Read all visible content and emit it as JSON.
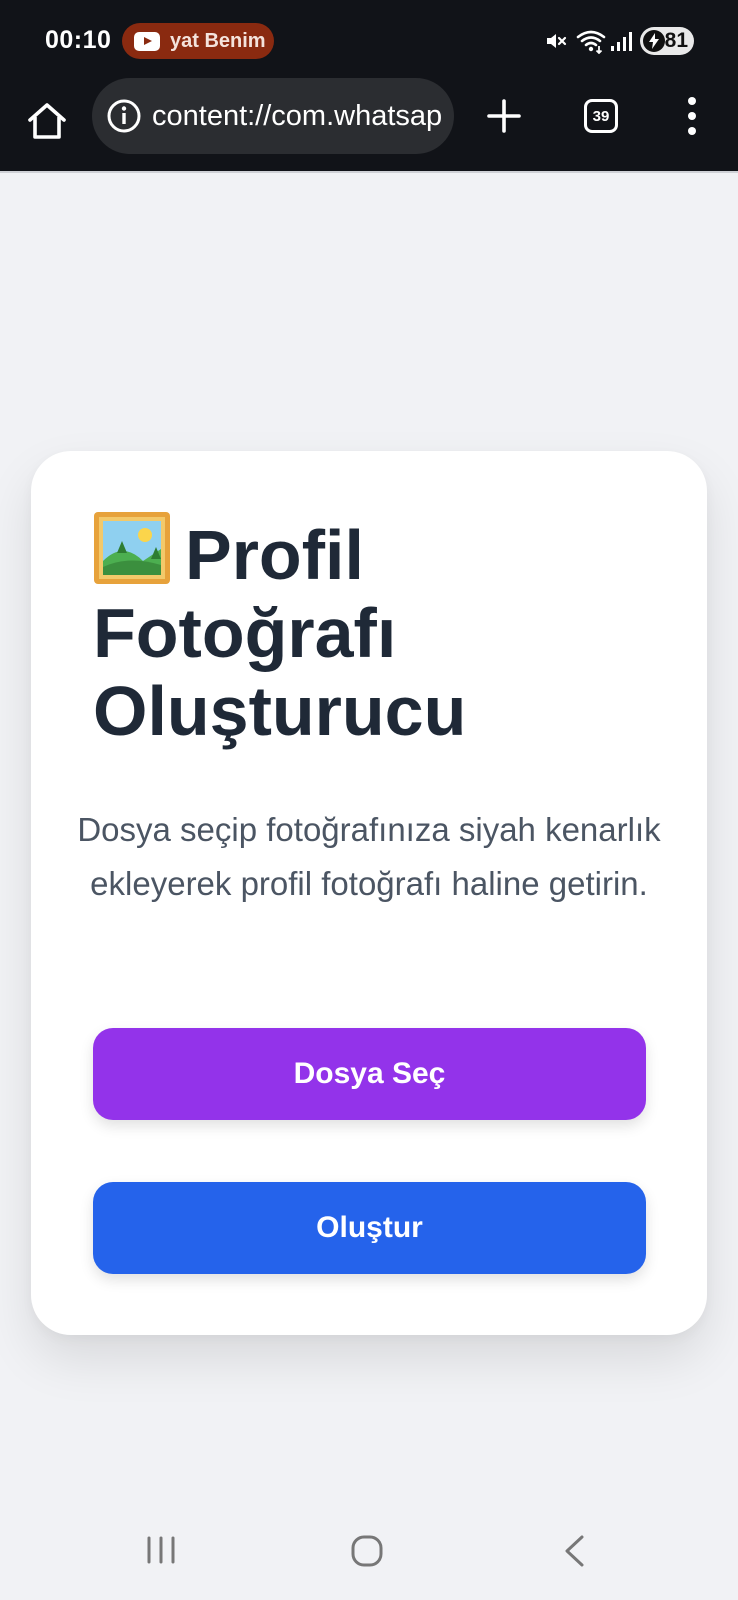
{
  "status_bar": {
    "time": "00:10",
    "notification_text": "yat Benim",
    "battery_level": "81",
    "icons": [
      "youtube-icon",
      "mute-icon",
      "wifi-icon",
      "signal-icon",
      "battery-charging-icon"
    ]
  },
  "browser": {
    "url": "content://com.whatsapp",
    "tab_count": "39",
    "icons": [
      "home-icon",
      "info-icon",
      "plus-icon",
      "tabs-icon",
      "more-vert-icon"
    ]
  },
  "card": {
    "title_icon": "framed-picture-emoji",
    "title": "Profil Fotoğrafı Oluşturucu",
    "description": "Dosya seçip fotoğrafınıza siyah kenarlık ekleyerek profil fotoğrafı haline getirin.",
    "select_button": "Dosya Seç",
    "create_button": "Oluştur",
    "colors": {
      "select_button": "#9333ea",
      "create_button": "#2563eb",
      "title": "#1f2937",
      "description": "#4b5563"
    }
  },
  "navbar": {
    "icons": [
      "recent-apps-icon",
      "home-circle-icon",
      "back-icon"
    ]
  }
}
